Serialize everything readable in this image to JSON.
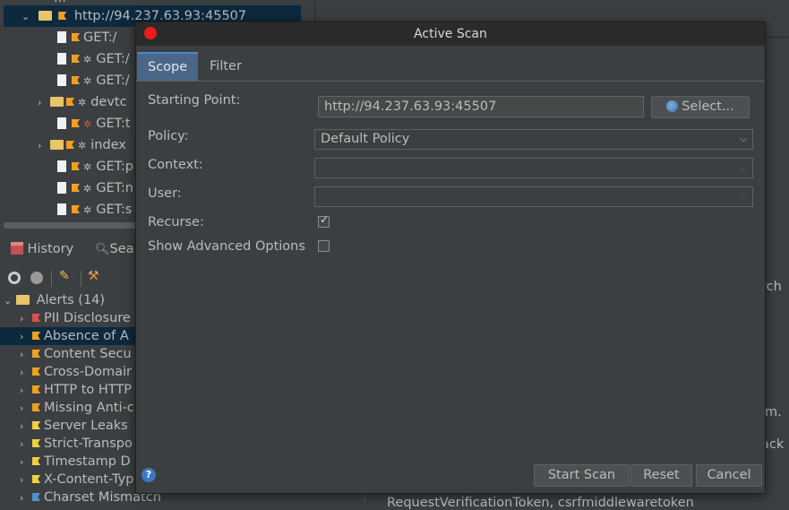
{
  "tree": {
    "root_label": "http://94.237.63.93:45507",
    "top_partial": "...",
    "items": [
      {
        "label": "GET:/"
      },
      {
        "label": "GET:/"
      },
      {
        "label": "GET:/"
      },
      {
        "label": "devtc"
      },
      {
        "label": "GET:t"
      },
      {
        "label": "index"
      },
      {
        "label": "GET:p"
      },
      {
        "label": "GET:n"
      },
      {
        "label": "GET:s"
      }
    ]
  },
  "bottom_tabs": {
    "history": "History",
    "search": "Sea"
  },
  "alerts": {
    "header": "Alerts (14)",
    "items": [
      {
        "label": "PII Disclosure",
        "color": "#e05050"
      },
      {
        "label": "Absence of A",
        "color": "#f0a020"
      },
      {
        "label": "Content Secu",
        "color": "#f0a020"
      },
      {
        "label": "Cross-Domair",
        "color": "#f0a020"
      },
      {
        "label": "HTTP to HTTP",
        "color": "#f0a020"
      },
      {
        "label": "Missing Anti-c",
        "color": "#f0a020"
      },
      {
        "label": "Server Leaks",
        "color": "#f0d040"
      },
      {
        "label": "Strict-Transpo",
        "color": "#f0d040"
      },
      {
        "label": "Timestamp D",
        "color": "#f0d040"
      },
      {
        "label": "X-Content-Typ",
        "color": "#f0d040"
      },
      {
        "label": "Charset Mismatch",
        "color": "#5090d0"
      }
    ]
  },
  "right_panel": {
    "text1": "rch",
    "text2": "im.",
    "text3": "ack",
    "bottom_text": "RequestVerificationToken, csrfmiddlewaretoken"
  },
  "dialog": {
    "title": "Active Scan",
    "tabs": [
      {
        "label": "Scope",
        "active": true
      },
      {
        "label": "Filter",
        "active": false
      }
    ],
    "starting_point_label": "Starting Point:",
    "starting_point_value": "http://94.237.63.93:45507",
    "select_button": "Select...",
    "policy_label": "Policy:",
    "policy_value": "Default Policy",
    "context_label": "Context:",
    "context_value": "",
    "user_label": "User:",
    "user_value": "",
    "recurse_label": "Recurse:",
    "recurse_checked": true,
    "advanced_label": "Show Advanced Options",
    "advanced_checked": false,
    "start_button": "Start Scan",
    "reset_button": "Reset",
    "cancel_button": "Cancel"
  },
  "colors": {
    "background": "#3c3f41",
    "titlebar": "#2b2b2b",
    "close": "#ec1c1c",
    "active_tab": "#4a6788",
    "selection": "#0d293e"
  }
}
